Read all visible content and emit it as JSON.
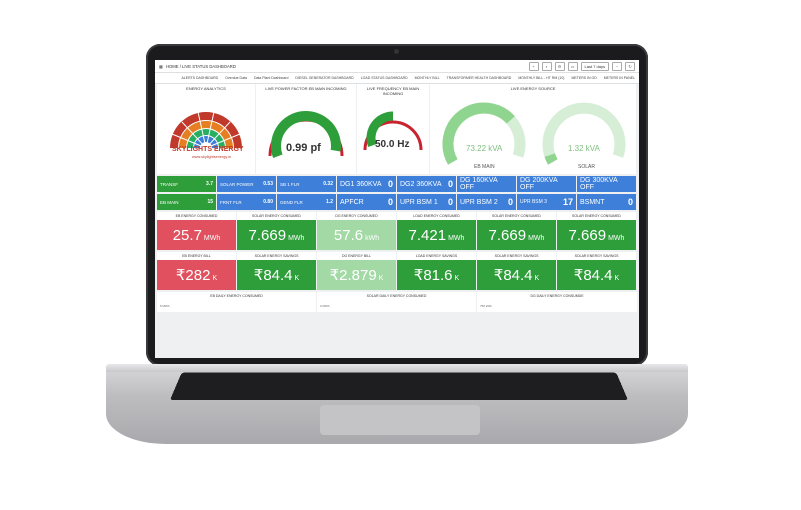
{
  "window": {
    "title": "HOME / LIVE STATUS DASHBOARD",
    "time_range": "Last 7 days"
  },
  "links": [
    "ALERTS DASHBOARD",
    "Overdue Data",
    "Data Plant Dashboard",
    "DIESEL GENERATOR DASHBOARD",
    "LOAD STATUS DASHBOARD",
    "MONTHLY BILL",
    "TRANSFORMER HEALTH DASHBOARD",
    "MONTHLY BILL - HT RM (10)",
    "METERS IN GD",
    "METERS IN PANEL"
  ],
  "logo": {
    "panel_title": "ENERGY ANALYTICS",
    "name": "SKYLIGHTS ENERGY",
    "url": "www.skylightsenergy.in"
  },
  "gauges": {
    "pf": {
      "title": "LIVE POWER FACTOR EB MAIN INCOMING",
      "value": "0.99 pf",
      "level": 0.95
    },
    "freq": {
      "title": "LIVE FREQUENCY EB MAIN INCOMING",
      "value": "50.0 Hz",
      "level": 0.5
    },
    "source": {
      "title": "LIVE ENERGY SOURCE",
      "eb_value": "73.22 kVA",
      "eb_label": "EB MAIN",
      "solar_value": "1.32 kVA",
      "solar_label": "SOLAR",
      "eb_level": 0.7,
      "solar_level": 0.05
    }
  },
  "tiles": {
    "transf": {
      "label": "TRANSF",
      "value": "3.7"
    },
    "eb_main": {
      "label": "EB MAIN",
      "value": "15"
    },
    "solar_power": {
      "label": "SOLAR POWER",
      "value": "0.53"
    },
    "frnt_flr": {
      "label": "FRNT FLR",
      "value": "0.80"
    },
    "sb": {
      "label": "SB 1 FLR",
      "value": "0.32"
    },
    "gend_flr": {
      "label": "GEND FLR",
      "value": "1.2"
    },
    "dg1": {
      "label": "DG1 360KVA",
      "value": "0"
    },
    "apfcr": {
      "label": "APFCR",
      "value": "0"
    },
    "dg2": {
      "label": "DG2 360KVA",
      "value": "0"
    },
    "upr_bsm1": {
      "label": "UPR BSM 1",
      "value": "0"
    },
    "dg160": {
      "label": "DG 160KVA OFF"
    },
    "upr_bsm2": {
      "label": "UPR BSM 2",
      "value": "0"
    },
    "dg200": {
      "label": "DG 200KVA OFF"
    },
    "upr_bsm3": {
      "label": "UPR BSM 3",
      "value": "17"
    },
    "dg300": {
      "label": "DG 300KVA OFF"
    },
    "bsmnt": {
      "label": "BSMNT",
      "value": "0"
    }
  },
  "consumption": [
    {
      "label": "EB ENERGY CONSUMED",
      "value": "25.7",
      "unit": "MWh",
      "color": "#e0505e"
    },
    {
      "label": "SOLAR ENERGY CONSUMED",
      "value": "7.669",
      "unit": "MWh",
      "color": "#2e9e3a"
    },
    {
      "label": "DG ENERGY CONSUMED",
      "value": "57.6",
      "unit": "kWh",
      "color": "#a3d9a5"
    },
    {
      "label": "LOAD ENERGY CONSUMED",
      "value": "7.421",
      "unit": "MWh",
      "color": "#2e9e3a"
    },
    {
      "label": "SOLAR ENERGY CONSUMED",
      "value": "7.669",
      "unit": "MWh",
      "color": "#2e9e3a"
    },
    {
      "label": "SOLAR ENERGY CONSUMED",
      "value": "7.669",
      "unit": "MWh",
      "color": "#2e9e3a"
    }
  ],
  "bills": [
    {
      "label": "EB ENERGY BILL",
      "value": "₹282",
      "unit": "K",
      "color": "#e0505e"
    },
    {
      "label": "SOLAR ENERGY SAVINGS",
      "value": "₹84.4",
      "unit": "K",
      "color": "#2e9e3a"
    },
    {
      "label": "DG ENERGY BILL",
      "value": "₹2.879",
      "unit": "K",
      "color": "#a3d9a5"
    },
    {
      "label": "LOAD ENERGY SAVINGS",
      "value": "₹81.6",
      "unit": "K",
      "color": "#2e9e3a"
    },
    {
      "label": "SOLAR ENERGY SAVINGS",
      "value": "₹84.4",
      "unit": "K",
      "color": "#2e9e3a"
    },
    {
      "label": "SOLAR ENERGY SAVINGS",
      "value": "₹84.4",
      "unit": "K",
      "color": "#2e9e3a"
    }
  ],
  "daily": [
    {
      "label": "EB DAILY ENERGY CONSUMED",
      "small": "5 MWh"
    },
    {
      "label": "SOLAR DAILY ENERGY CONSUMED",
      "small": "2 MWh"
    },
    {
      "label": "DG DAILY ENERGY CONSUMDE",
      "small": "750 kWh"
    }
  ],
  "colors": {
    "green": "#2e9e3a",
    "blue": "#3d7fd9",
    "red": "#e0505e",
    "light_green": "#a3d9a5"
  }
}
